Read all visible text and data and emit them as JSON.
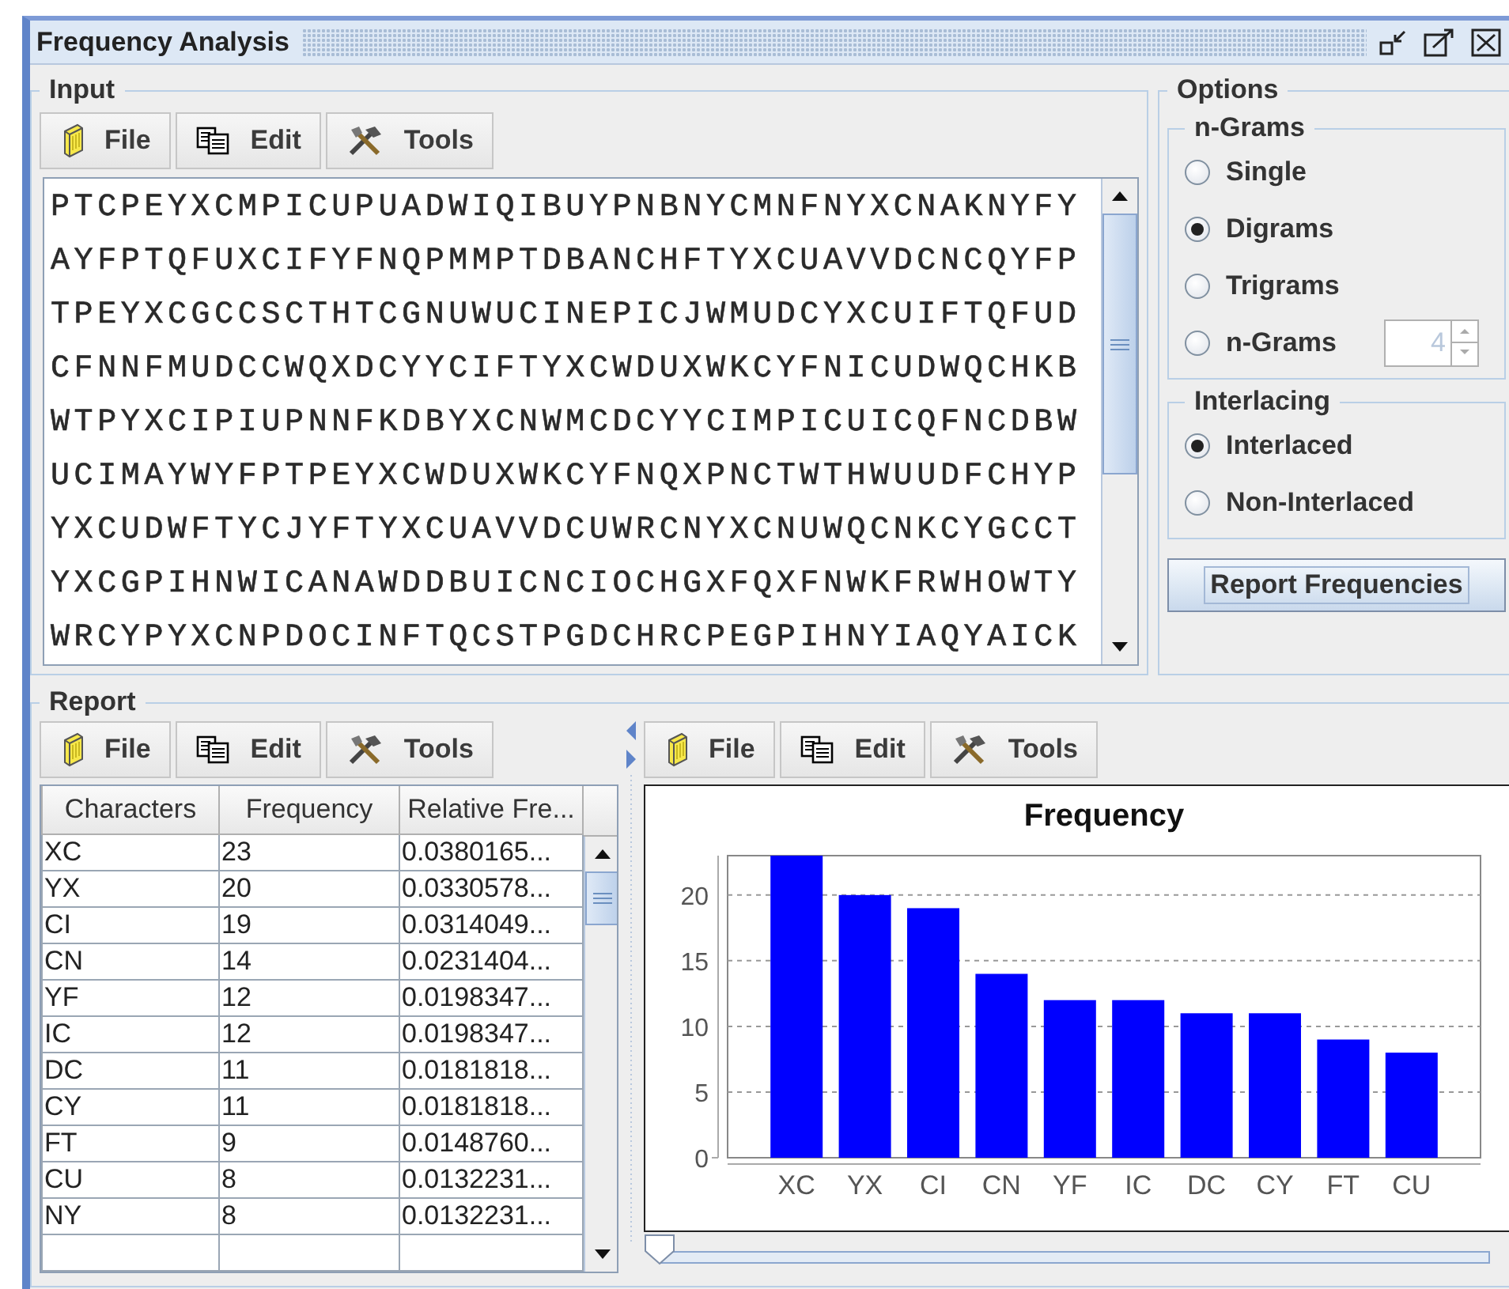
{
  "window": {
    "title": "Frequency Analysis"
  },
  "input": {
    "title": "Input",
    "toolbar": [
      {
        "label": "File",
        "kind": "file"
      },
      {
        "label": "Edit",
        "kind": "edit"
      },
      {
        "label": "Tools",
        "kind": "tools"
      }
    ],
    "text_lines": [
      "PTCPEYXCMPICUPUADWIQIBUYPNBNYCMNFNYXCNAKNYFY",
      "AYFPTQFUXCIFYFNQPMMPTDBANCHFTYXCUAVVDCNCQYFP",
      "TPEYXCGCCSCTHTCGNUWUCINEPICJWMUDCYXCUIFTQFUD",
      "CFNNFMUDCCWQXDCYYCIFTYXCWDUXWKCYFNICUDWQCHKB",
      "WTPYXCIPIUPNNFKDBYXCNWMCDCYYCIMPICUICQFNCDBW",
      "UCIMAYWYFPTPEYXCWDUXWKCYFNQXPNCTWTHWUUDFCHYP",
      "YXCUDWFTYCJYFTYXCUAVVDCUWRCNYXCNUWQCNKCYGCCT",
      "YXCGPIHNWICANAWDDBUICNCIOCHGXFQXFNWKFRWHOWTY",
      "WRCYPYXCNPDOCINFTQCSTPGDCHRCPEGPIHNYIAQYAICK"
    ]
  },
  "options": {
    "title": "Options",
    "ngrams": {
      "title": "n-Grams",
      "choices": [
        {
          "label": "Single",
          "selected": false
        },
        {
          "label": "Digrams",
          "selected": true
        },
        {
          "label": "Trigrams",
          "selected": false
        },
        {
          "label": "n-Grams",
          "selected": false
        }
      ],
      "spinner": {
        "value": "4",
        "disabled": true
      }
    },
    "interlacing": {
      "title": "Interlacing",
      "choices": [
        {
          "label": "Interlaced",
          "selected": true
        },
        {
          "label": "Non-Interlaced",
          "selected": false
        }
      ]
    },
    "button": "Report Frequencies"
  },
  "report": {
    "title": "Report",
    "table_toolbar": [
      {
        "label": "File",
        "kind": "file"
      },
      {
        "label": "Edit",
        "kind": "edit"
      },
      {
        "label": "Tools",
        "kind": "tools"
      }
    ],
    "table": {
      "columns": [
        "Characters",
        "Frequency",
        "Relative Fre..."
      ],
      "rows": [
        [
          "XC",
          "23",
          "0.0380165..."
        ],
        [
          "YX",
          "20",
          "0.0330578..."
        ],
        [
          "CI",
          "19",
          "0.0314049..."
        ],
        [
          "CN",
          "14",
          "0.0231404..."
        ],
        [
          "YF",
          "12",
          "0.0198347..."
        ],
        [
          "IC",
          "12",
          "0.0198347..."
        ],
        [
          "DC",
          "11",
          "0.0181818..."
        ],
        [
          "CY",
          "11",
          "0.0181818..."
        ],
        [
          "FT",
          "9",
          "0.0148760..."
        ],
        [
          "CU",
          "8",
          "0.0132231..."
        ],
        [
          "NY",
          "8",
          "0.0132231..."
        ]
      ]
    },
    "chart_toolbar": [
      {
        "label": "File",
        "kind": "file"
      },
      {
        "label": "Edit",
        "kind": "edit"
      },
      {
        "label": "Tools",
        "kind": "tools"
      }
    ],
    "chart_data": {
      "type": "bar",
      "title": "Frequency",
      "categories": [
        "XC",
        "YX",
        "CI",
        "CN",
        "YF",
        "IC",
        "DC",
        "CY",
        "FT",
        "CU"
      ],
      "series": [
        {
          "color": "#0000ff",
          "values": [
            23,
            20,
            19,
            14,
            12,
            12,
            11,
            11,
            9,
            8
          ]
        }
      ],
      "ylim": [
        0,
        23
      ],
      "yticks": [
        0,
        5,
        10,
        15,
        20
      ],
      "grid": true
    },
    "zoom_slider": {
      "level": 0
    }
  }
}
